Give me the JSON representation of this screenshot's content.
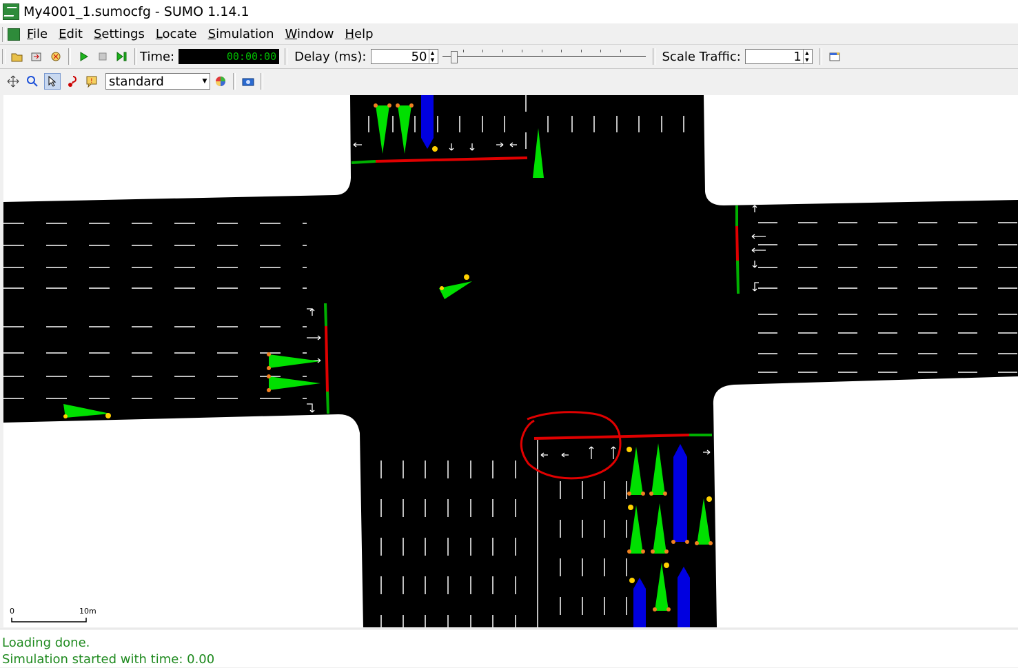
{
  "window": {
    "title": "My4001_1.sumocfg - SUMO 1.14.1"
  },
  "menu": {
    "items": [
      {
        "accel": "F",
        "rest": "ile"
      },
      {
        "accel": "E",
        "rest": "dit"
      },
      {
        "accel": "S",
        "rest": "ettings"
      },
      {
        "accel": "L",
        "rest": "ocate"
      },
      {
        "accel": "S",
        "rest": "imulation"
      },
      {
        "accel": "W",
        "rest": "indow"
      },
      {
        "accel": "H",
        "rest": "elp"
      }
    ]
  },
  "toolbar": {
    "time_label": "Time:",
    "time_value": "00:00:00",
    "delay_label": "Delay (ms):",
    "delay_value": "50",
    "scale_label": "Scale Traffic:",
    "scale_value": "1"
  },
  "viewbar": {
    "scheme": "standard"
  },
  "scale_bar": {
    "start": "0",
    "end": "10m"
  },
  "status": {
    "lines": [
      "Loading done.",
      "Simulation started with time: 0.00"
    ]
  },
  "colors": {
    "road": "#000000",
    "signal_red": "#e00000",
    "signal_green": "#00b000",
    "vehicle_green": "#00e000",
    "vehicle_blue": "#0000e0",
    "status_text": "#1f8a1f",
    "annotation": "#e00000"
  },
  "icons": [
    "open-icon",
    "reload-icon",
    "close-sim-icon",
    "run-icon",
    "stop-icon",
    "step-icon",
    "recenter-icon",
    "zoom-icon",
    "select-icon",
    "locate-icon",
    "tooltip-icon",
    "color-wheel-icon",
    "screenshot-icon",
    "window-icon"
  ]
}
